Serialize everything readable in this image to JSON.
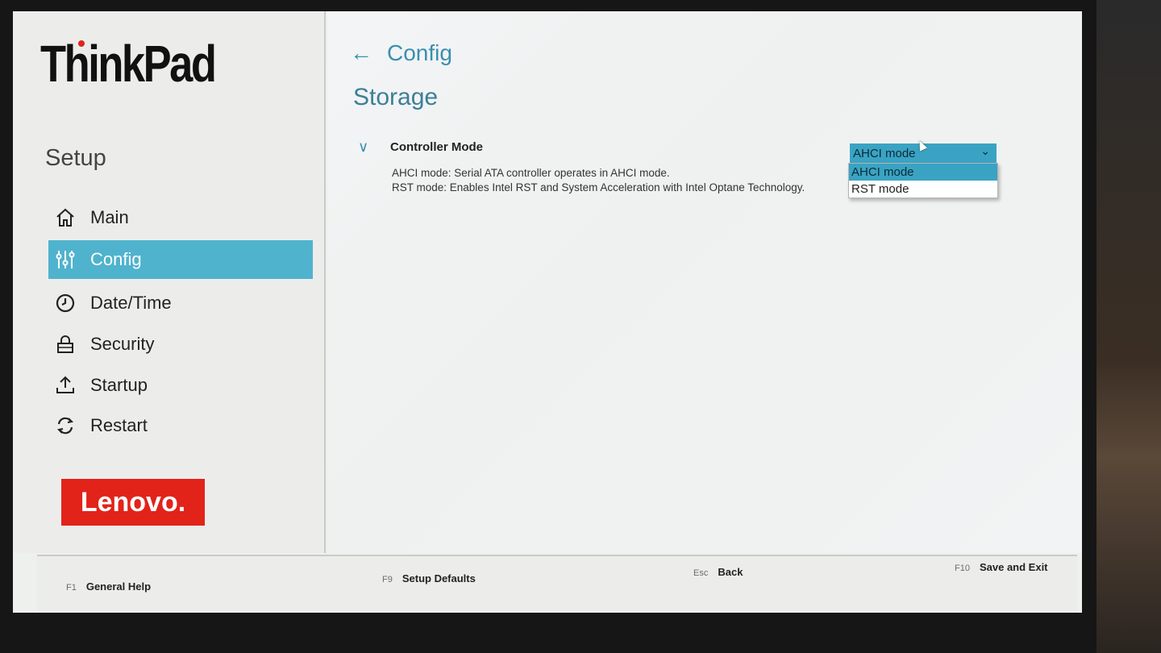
{
  "brand": {
    "product_logo": "ThinkPad",
    "vendor_logo": "Lenovo."
  },
  "sidebar": {
    "title": "Setup",
    "items": [
      {
        "label": "Main",
        "icon": "home-icon",
        "active": false
      },
      {
        "label": "Config",
        "icon": "sliders-icon",
        "active": true
      },
      {
        "label": "Date/Time",
        "icon": "clock-icon",
        "active": false
      },
      {
        "label": "Security",
        "icon": "lock-icon",
        "active": false
      },
      {
        "label": "Startup",
        "icon": "upload-icon",
        "active": false
      },
      {
        "label": "Restart",
        "icon": "refresh-icon",
        "active": false
      }
    ]
  },
  "main": {
    "breadcrumb": "Config",
    "page_title": "Storage",
    "setting": {
      "label": "Controller Mode",
      "desc_line1": "AHCI mode: Serial ATA controller operates in AHCI mode.",
      "desc_line2": "RST mode: Enables Intel RST and System Acceleration with Intel Optane Technology.",
      "selected": "AHCI mode",
      "options": [
        "AHCI mode",
        "RST mode"
      ]
    }
  },
  "footer": {
    "f1": {
      "key": "F1",
      "label": "General Help"
    },
    "f9": {
      "key": "F9",
      "label": "Setup Defaults"
    },
    "esc": {
      "key": "Esc",
      "label": "Back"
    },
    "f10": {
      "key": "F10",
      "label": "Save and Exit"
    }
  },
  "colors": {
    "accent": "#4fb3cd",
    "brand_red": "#e2231a"
  }
}
